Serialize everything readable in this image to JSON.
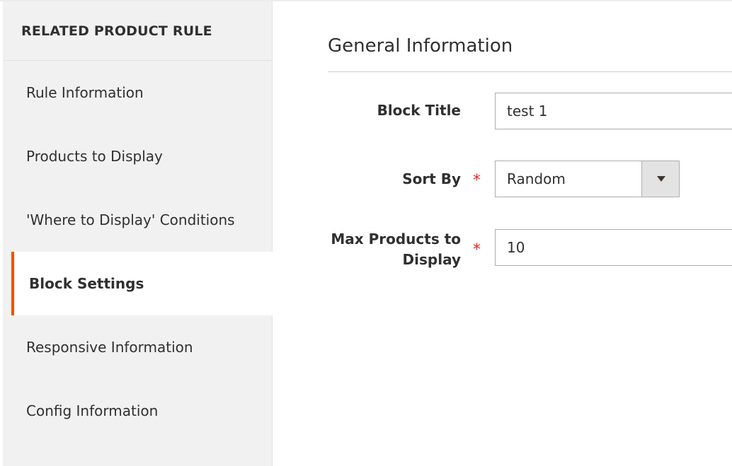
{
  "sidebar": {
    "title": "RELATED PRODUCT RULE",
    "items": [
      {
        "label": "Rule Information"
      },
      {
        "label": "Products to Display"
      },
      {
        "label": "'Where to Display' Conditions"
      },
      {
        "label": "Block Settings",
        "active": true
      },
      {
        "label": "Responsive Information"
      },
      {
        "label": "Config Information"
      }
    ]
  },
  "section": {
    "title": "General Information"
  },
  "form": {
    "block_title": {
      "label": "Block Title",
      "value": "test 1"
    },
    "sort_by": {
      "label": "Sort By",
      "required_mark": "*",
      "value": "Random",
      "icon": "chevron-down-icon"
    },
    "max_products": {
      "label_line1": "Max Products to",
      "label_line2": "Display",
      "required_mark": "*",
      "value": "10"
    }
  },
  "colors": {
    "accent": "#eb5202",
    "required": "#e22626",
    "sidebar_bg": "#f1f1f1"
  }
}
